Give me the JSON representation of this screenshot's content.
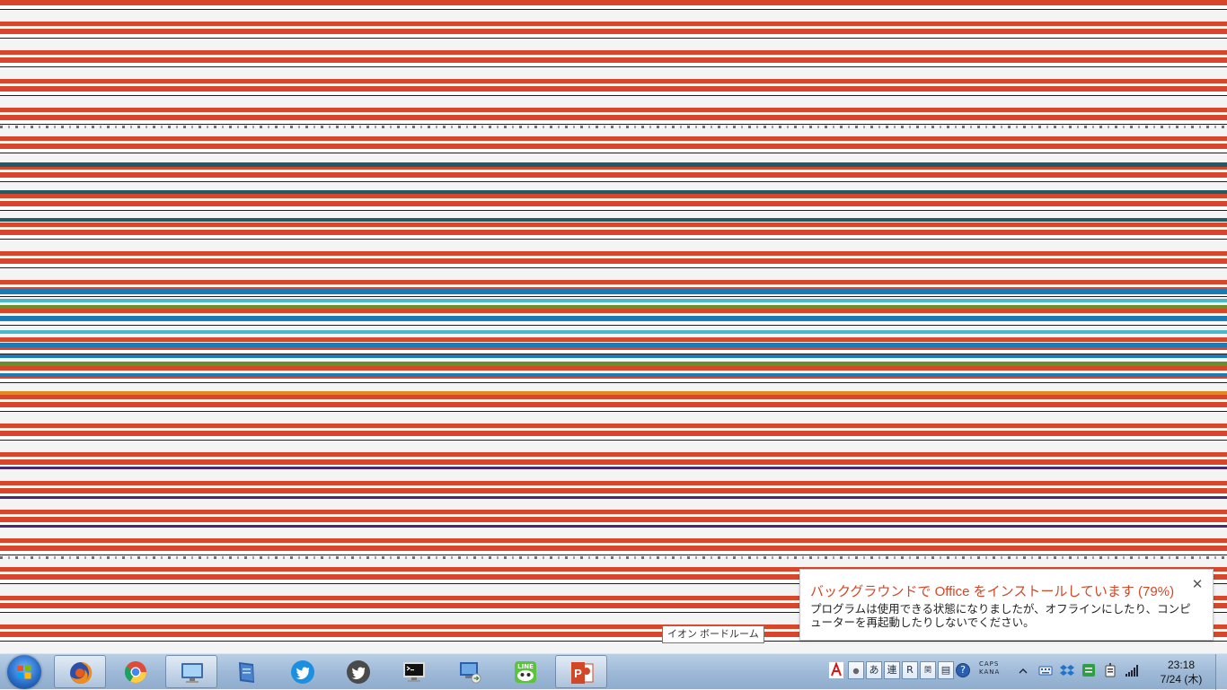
{
  "notification": {
    "title": "バックグラウンドで Office をインストールしています (79%)",
    "body": "プログラムは使用できる状態になりましたが、オフラインにしたり、コンピューターを再起動したりしないでください。",
    "progress_percent": 79,
    "close_icon": "close-icon",
    "accent": "#d24726"
  },
  "tooltip": {
    "text": "イオン ボードルーム"
  },
  "taskbar": {
    "start_icon": "windows-logo-icon",
    "apps": [
      {
        "name": "firefox-icon"
      },
      {
        "name": "chrome-icon"
      },
      {
        "name": "monitor-icon"
      },
      {
        "name": "notebook-icon"
      },
      {
        "name": "twitter-blue-icon"
      },
      {
        "name": "twitter-dark-icon"
      },
      {
        "name": "command-prompt-icon"
      },
      {
        "name": "remote-desktop-icon"
      },
      {
        "name": "line-icon",
        "label": "LINE"
      },
      {
        "name": "powerpoint-icon",
        "label": "P"
      }
    ],
    "ime": {
      "items": [
        "あ",
        "連",
        "R",
        "関",
        "▤",
        "?"
      ]
    },
    "caps_text": "CAPS",
    "kana_text": "KANA",
    "clock": {
      "time": "23:18",
      "date": "7/24 (木)"
    }
  },
  "colors": {
    "stripe_red": "#d9472b",
    "stripe_teal": "#1f5a66",
    "stripe_blue": "#1b7bb5",
    "stripe_purple": "#4b2a6e",
    "taskbar": "#a8c2de"
  }
}
